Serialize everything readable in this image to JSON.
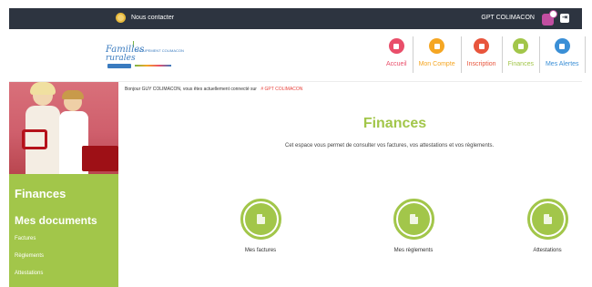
{
  "topbar": {
    "contact_label": "Nous contacter",
    "account_name": "GPT COLIMACON"
  },
  "logo": {
    "line1": "Familles",
    "line2": "rurales",
    "line3": "GROUPEMENT COLIMACON"
  },
  "nav": [
    {
      "label": "Accueil",
      "color": "#e94e6a",
      "icon": "home-icon"
    },
    {
      "label": "Mon Compte",
      "color": "#f5a623",
      "icon": "user-icon"
    },
    {
      "label": "Inscription",
      "color": "#e8553c",
      "icon": "pencil-icon"
    },
    {
      "label": "Finances",
      "color": "#a2c64a",
      "icon": "money-icon"
    },
    {
      "label": "Mes Alertes",
      "color": "#3a8fd6",
      "icon": "alert-icon"
    }
  ],
  "sidebar": {
    "title": "Finances",
    "section": "Mes documents",
    "links": [
      "Factures",
      "Règlements",
      "Attestations"
    ]
  },
  "main": {
    "welcome_text": "Bonjour GUY COLIMACON, vous êtes actuellement connecté sur",
    "welcome_account": "# GPT COLIMACON",
    "title": "Finances",
    "intro": "Cet espace vous permet de consulter vos factures, vos attestations et vos règlements.",
    "documents": [
      {
        "label": "Mes factures"
      },
      {
        "label": "Mes règlements"
      },
      {
        "label": "Attestations"
      }
    ]
  },
  "colors": {
    "topbar": "#2d3440",
    "accent_green": "#a2c64a"
  }
}
